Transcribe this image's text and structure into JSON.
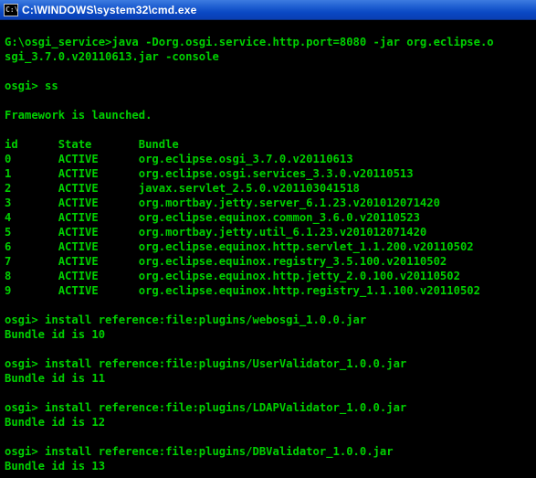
{
  "window": {
    "title": "C:\\WINDOWS\\system32\\cmd.exe",
    "icon": "console-icon",
    "text_color": "#00d000",
    "background": "#000000"
  },
  "console": {
    "lines": [
      "",
      "G:\\osgi_service>java -Dorg.osgi.service.http.port=8080 -jar org.eclipse.o",
      "sgi_3.7.0.v20110613.jar -console",
      "",
      "osgi> ss",
      "",
      "Framework is launched.",
      "",
      "id      State       Bundle",
      "0       ACTIVE      org.eclipse.osgi_3.7.0.v20110613",
      "1       ACTIVE      org.eclipse.osgi.services_3.3.0.v20110513",
      "2       ACTIVE      javax.servlet_2.5.0.v201103041518",
      "3       ACTIVE      org.mortbay.jetty.server_6.1.23.v201012071420",
      "4       ACTIVE      org.eclipse.equinox.common_3.6.0.v20110523",
      "5       ACTIVE      org.mortbay.jetty.util_6.1.23.v201012071420",
      "6       ACTIVE      org.eclipse.equinox.http.servlet_1.1.200.v20110502",
      "7       ACTIVE      org.eclipse.equinox.registry_3.5.100.v20110502",
      "8       ACTIVE      org.eclipse.equinox.http.jetty_2.0.100.v20110502",
      "9       ACTIVE      org.eclipse.equinox.http.registry_1.1.100.v20110502",
      "",
      "osgi> install reference:file:plugins/webosgi_1.0.0.jar",
      "Bundle id is 10",
      "",
      "osgi> install reference:file:plugins/UserValidator_1.0.0.jar",
      "Bundle id is 11",
      "",
      "osgi> install reference:file:plugins/LDAPValidator_1.0.0.jar",
      "Bundle id is 12",
      "",
      "osgi> install reference:file:plugins/DBValidator_1.0.0.jar",
      "Bundle id is 13"
    ]
  }
}
